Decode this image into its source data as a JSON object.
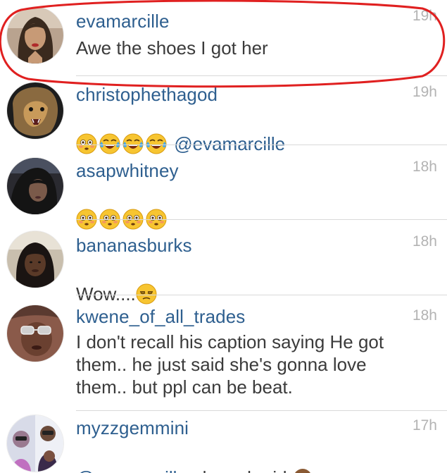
{
  "comments": [
    {
      "username": "evamarcille",
      "time": "19h",
      "text": "Awe the shoes I got her"
    },
    {
      "username": "christophethagod",
      "time": "19h",
      "mention": "@evamarcille",
      "emojis": [
        "flushed-face",
        "crying-laughing-face",
        "crying-laughing-face",
        "crying-laughing-face"
      ]
    },
    {
      "username": "asapwhitney",
      "time": "18h",
      "emojis": [
        "flushed-face",
        "flushed-face",
        "flushed-face",
        "flushed-face"
      ]
    },
    {
      "username": "bananasburks",
      "time": "18h",
      "text": "Wow....",
      "emojis": [
        "unamused-face"
      ]
    },
    {
      "username": "kwene_of_all_trades",
      "time": "18h",
      "text": "I don't recall his caption saying He got\nthem.. he just said she's gonna love\nthem.. but ppl can be beat."
    },
    {
      "username": "myzzgemmini",
      "time": "17h",
      "mention": "@evamarcille",
      "text": " oh gosh girl ",
      "emojis": [
        "see-no-evil-monkey"
      ]
    }
  ],
  "colors": {
    "username": "#2e5f8f",
    "time": "#b3b3b3",
    "comment_text": "#3b3b3b",
    "separator": "#d9d9d9",
    "highlight_ellipse": "#e02020"
  }
}
